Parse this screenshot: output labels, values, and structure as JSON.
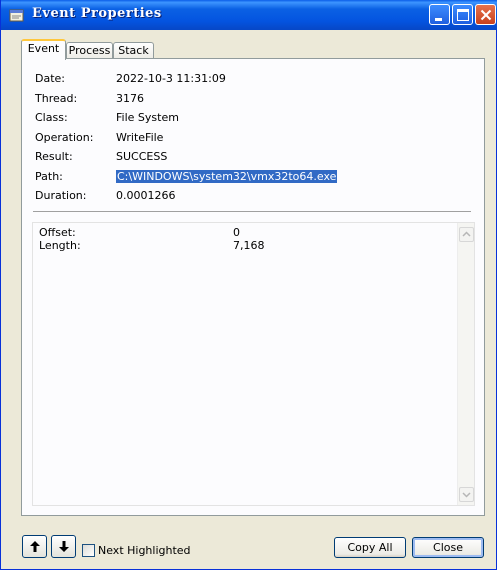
{
  "window": {
    "title": "Event Properties",
    "title_icon": "event-properties-icon",
    "controls": [
      "minimize-icon",
      "maximize-icon",
      "close-icon"
    ]
  },
  "tabs": [
    {
      "label": "Event",
      "active": true
    },
    {
      "label": "Process",
      "active": false
    },
    {
      "label": "Stack",
      "active": false
    }
  ],
  "properties": [
    {
      "label": "Date:",
      "value": "2022-10-3 11:31:09"
    },
    {
      "label": "Thread:",
      "value": "3176"
    },
    {
      "label": "Class:",
      "value": "File System"
    },
    {
      "label": "Operation:",
      "value": "WriteFile"
    },
    {
      "label": "Result:",
      "value": "SUCCESS"
    },
    {
      "label": "Path:",
      "value": "C:\\WINDOWS\\system32\\vmx32to64.exe"
    },
    {
      "label": "Duration:",
      "value": "0.0001266"
    }
  ],
  "details": [
    {
      "label": "Offset:",
      "value": "0"
    },
    {
      "label": "Length:",
      "value": "7,168"
    }
  ],
  "footer": {
    "up_icon": "arrow-up-icon",
    "down_icon": "arrow-down-icon",
    "next_highlighted_label": "Next Highlighted",
    "next_highlighted_checked": false,
    "copy_all_label": "Copy All",
    "close_label": "Close"
  },
  "colors": {
    "titlebar": "#0454e0",
    "selection": "#316ac5",
    "dialog_bg": "#ece9d8",
    "active_tab_accent": "#ffc73c"
  }
}
